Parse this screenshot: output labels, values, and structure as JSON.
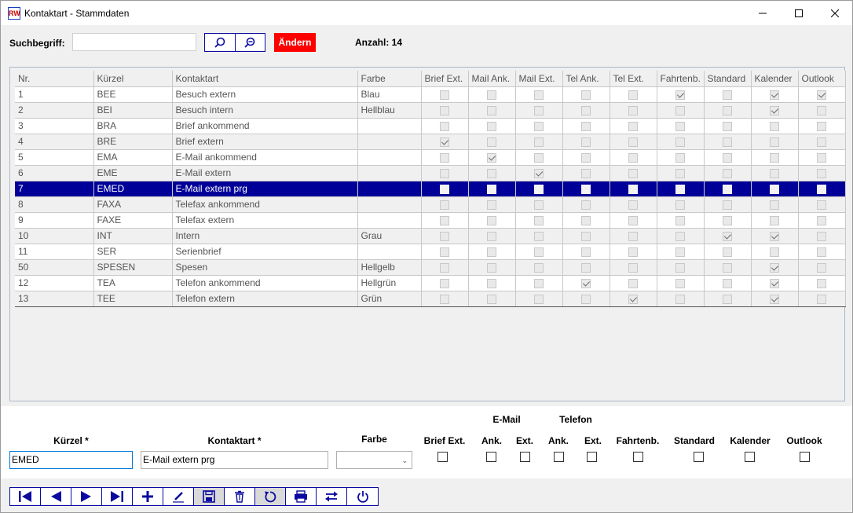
{
  "window": {
    "title": "Kontaktart - Stammdaten",
    "app_icon_text": "RW"
  },
  "search": {
    "label": "Suchbegriff:",
    "value": "",
    "change_label": "Ändern",
    "count_label": "Anzahl: 14"
  },
  "grid": {
    "columns": [
      "Nr.",
      "Kürzel",
      "Kontaktart",
      "Farbe",
      "Brief Ext.",
      "Mail Ank.",
      "Mail Ext.",
      "Tel Ank.",
      "Tel Ext.",
      "Fahrtenb.",
      "Standard",
      "Kalender",
      "Outlook"
    ],
    "rows": [
      {
        "nr": "1",
        "kuerzel": "BEE",
        "kontaktart": "Besuch extern",
        "farbe": "Blau",
        "flags": [
          0,
          0,
          0,
          0,
          0,
          1,
          0,
          1,
          1
        ]
      },
      {
        "nr": "2",
        "kuerzel": "BEI",
        "kontaktart": "Besuch intern",
        "farbe": "Hellblau",
        "flags": [
          0,
          0,
          0,
          0,
          0,
          0,
          0,
          1,
          0
        ]
      },
      {
        "nr": "3",
        "kuerzel": "BRA",
        "kontaktart": "Brief ankommend",
        "farbe": "",
        "flags": [
          0,
          0,
          0,
          0,
          0,
          0,
          0,
          0,
          0
        ]
      },
      {
        "nr": "4",
        "kuerzel": "BRE",
        "kontaktart": "Brief extern",
        "farbe": "",
        "flags": [
          1,
          0,
          0,
          0,
          0,
          0,
          0,
          0,
          0
        ]
      },
      {
        "nr": "5",
        "kuerzel": "EMA",
        "kontaktart": "E-Mail ankommend",
        "farbe": "",
        "flags": [
          0,
          1,
          0,
          0,
          0,
          0,
          0,
          0,
          0
        ]
      },
      {
        "nr": "6",
        "kuerzel": "EME",
        "kontaktart": "E-Mail extern",
        "farbe": "",
        "flags": [
          0,
          0,
          1,
          0,
          0,
          0,
          0,
          0,
          0
        ]
      },
      {
        "nr": "7",
        "kuerzel": "EMED",
        "kontaktart": "E-Mail extern prg",
        "farbe": "",
        "flags": [
          0,
          0,
          0,
          0,
          0,
          0,
          0,
          0,
          0
        ],
        "selected": true
      },
      {
        "nr": "8",
        "kuerzel": "FAXA",
        "kontaktart": "Telefax ankommend",
        "farbe": "",
        "flags": [
          0,
          0,
          0,
          0,
          0,
          0,
          0,
          0,
          0
        ]
      },
      {
        "nr": "9",
        "kuerzel": "FAXE",
        "kontaktart": "Telefax extern",
        "farbe": "",
        "flags": [
          0,
          0,
          0,
          0,
          0,
          0,
          0,
          0,
          0
        ]
      },
      {
        "nr": "10",
        "kuerzel": "INT",
        "kontaktart": "Intern",
        "farbe": "Grau",
        "flags": [
          0,
          0,
          0,
          0,
          0,
          0,
          1,
          1,
          0
        ]
      },
      {
        "nr": "11",
        "kuerzel": "SER",
        "kontaktart": "Serienbrief",
        "farbe": "",
        "flags": [
          0,
          0,
          0,
          0,
          0,
          0,
          0,
          0,
          0
        ]
      },
      {
        "nr": "50",
        "kuerzel": "SPESEN",
        "kontaktart": "Spesen",
        "farbe": "Hellgelb",
        "flags": [
          0,
          0,
          0,
          0,
          0,
          0,
          0,
          1,
          0
        ]
      },
      {
        "nr": "12",
        "kuerzel": "TEA",
        "kontaktart": "Telefon ankommend",
        "farbe": "Hellgrün",
        "flags": [
          0,
          0,
          0,
          1,
          0,
          0,
          0,
          1,
          0
        ]
      },
      {
        "nr": "13",
        "kuerzel": "TEE",
        "kontaktart": "Telefon extern",
        "farbe": "Grün",
        "flags": [
          0,
          0,
          0,
          0,
          1,
          0,
          0,
          1,
          0
        ]
      }
    ]
  },
  "form": {
    "kuerzel_label": "Kürzel *",
    "kuerzel_value": "EMED",
    "kontaktart_label": "Kontaktart *",
    "kontaktart_value": "E-Mail extern prg",
    "farbe_label": "Farbe",
    "farbe_value": "",
    "group_email": "E-Mail",
    "group_telefon": "Telefon",
    "brief_ext": "Brief Ext.",
    "mail_ank": "Ank.",
    "mail_ext": "Ext.",
    "tel_ank": "Ank.",
    "tel_ext": "Ext.",
    "fahrtenb": "Fahrtenb.",
    "standard": "Standard",
    "kalender": "Kalender",
    "outlook": "Outlook"
  },
  "toolbar": {
    "buttons": [
      "first-record-icon",
      "previous-record-icon",
      "next-record-icon",
      "last-record-icon",
      "add-icon",
      "edit-icon",
      "save-icon",
      "delete-icon",
      "undo-icon",
      "print-icon",
      "sync-icon",
      "power-icon"
    ]
  },
  "colors": {
    "accent": "#0a0aa0",
    "selection": "#000099",
    "change_button": "#ff0000"
  }
}
